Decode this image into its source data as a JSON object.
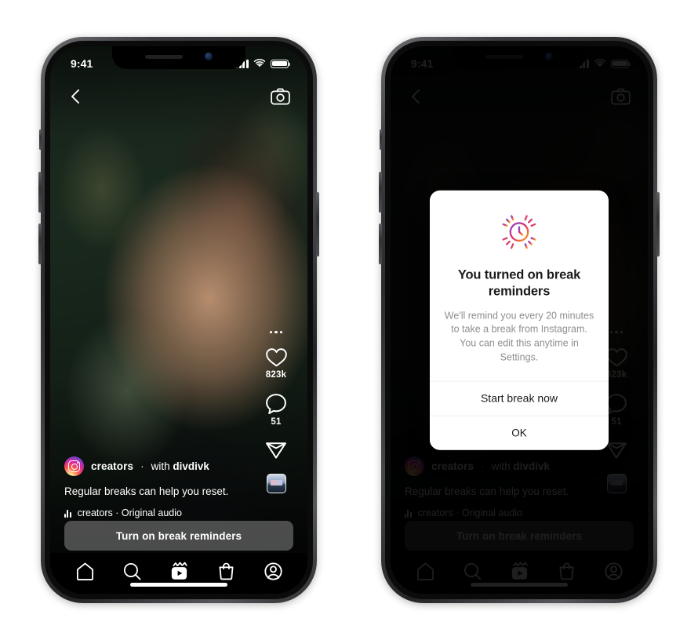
{
  "meta": {
    "app": "Instagram",
    "screen": "Reels — take a break reminder"
  },
  "status_bar": {
    "time": "9:41",
    "signal_icon": "cellular-bars-icon",
    "wifi_icon": "wifi-icon",
    "battery_icon": "battery-full-icon"
  },
  "top_nav": {
    "back_icon": "chevron-left-icon",
    "camera_icon": "camera-icon"
  },
  "reel": {
    "more_icon": "ellipsis-icon",
    "like": {
      "icon": "heart-icon",
      "count": "823k"
    },
    "comment": {
      "icon": "comment-bubble-icon",
      "count": "51"
    },
    "share": {
      "icon": "paper-plane-icon"
    },
    "audio_thumbnail_icon": "audio-thumbnail-icon",
    "caption": {
      "avatar_icon": "instagram-logo-avatar",
      "username": "creators",
      "separator": "·",
      "with_prefix": "with ",
      "with_user": "divdivk",
      "text": "Regular breaks can help you reset.",
      "audio_icon": "audio-bars-icon",
      "audio_label": "creators · Original audio"
    },
    "cta_label": "Turn on break reminders"
  },
  "tab_bar": {
    "items": [
      {
        "name": "home",
        "icon": "home-icon",
        "active": false
      },
      {
        "name": "search",
        "icon": "search-icon",
        "active": false
      },
      {
        "name": "reels",
        "icon": "reels-icon",
        "active": true
      },
      {
        "name": "shop",
        "icon": "shop-bag-icon",
        "active": false
      },
      {
        "name": "profile",
        "icon": "profile-icon",
        "active": false
      }
    ]
  },
  "modal": {
    "icon": "break-reminder-clock-icon",
    "title": "You turned on break reminders",
    "body": "We'll remind you every 20 minutes to take a break from Instagram. You can edit this anytime in Settings.",
    "primary_action": "Start break now",
    "secondary_action": "OK"
  },
  "colors": {
    "accent_gradient_start": "#7f4bd8",
    "accent_gradient_mid": "#e1306c",
    "accent_gradient_end": "#f9a825",
    "modal_background": "#ffffff",
    "modal_title": "#1a1a1a",
    "modal_body_text": "#8e8e8e",
    "screen_background": "#000000",
    "cta_background": "rgba(120,120,120,.62)"
  }
}
